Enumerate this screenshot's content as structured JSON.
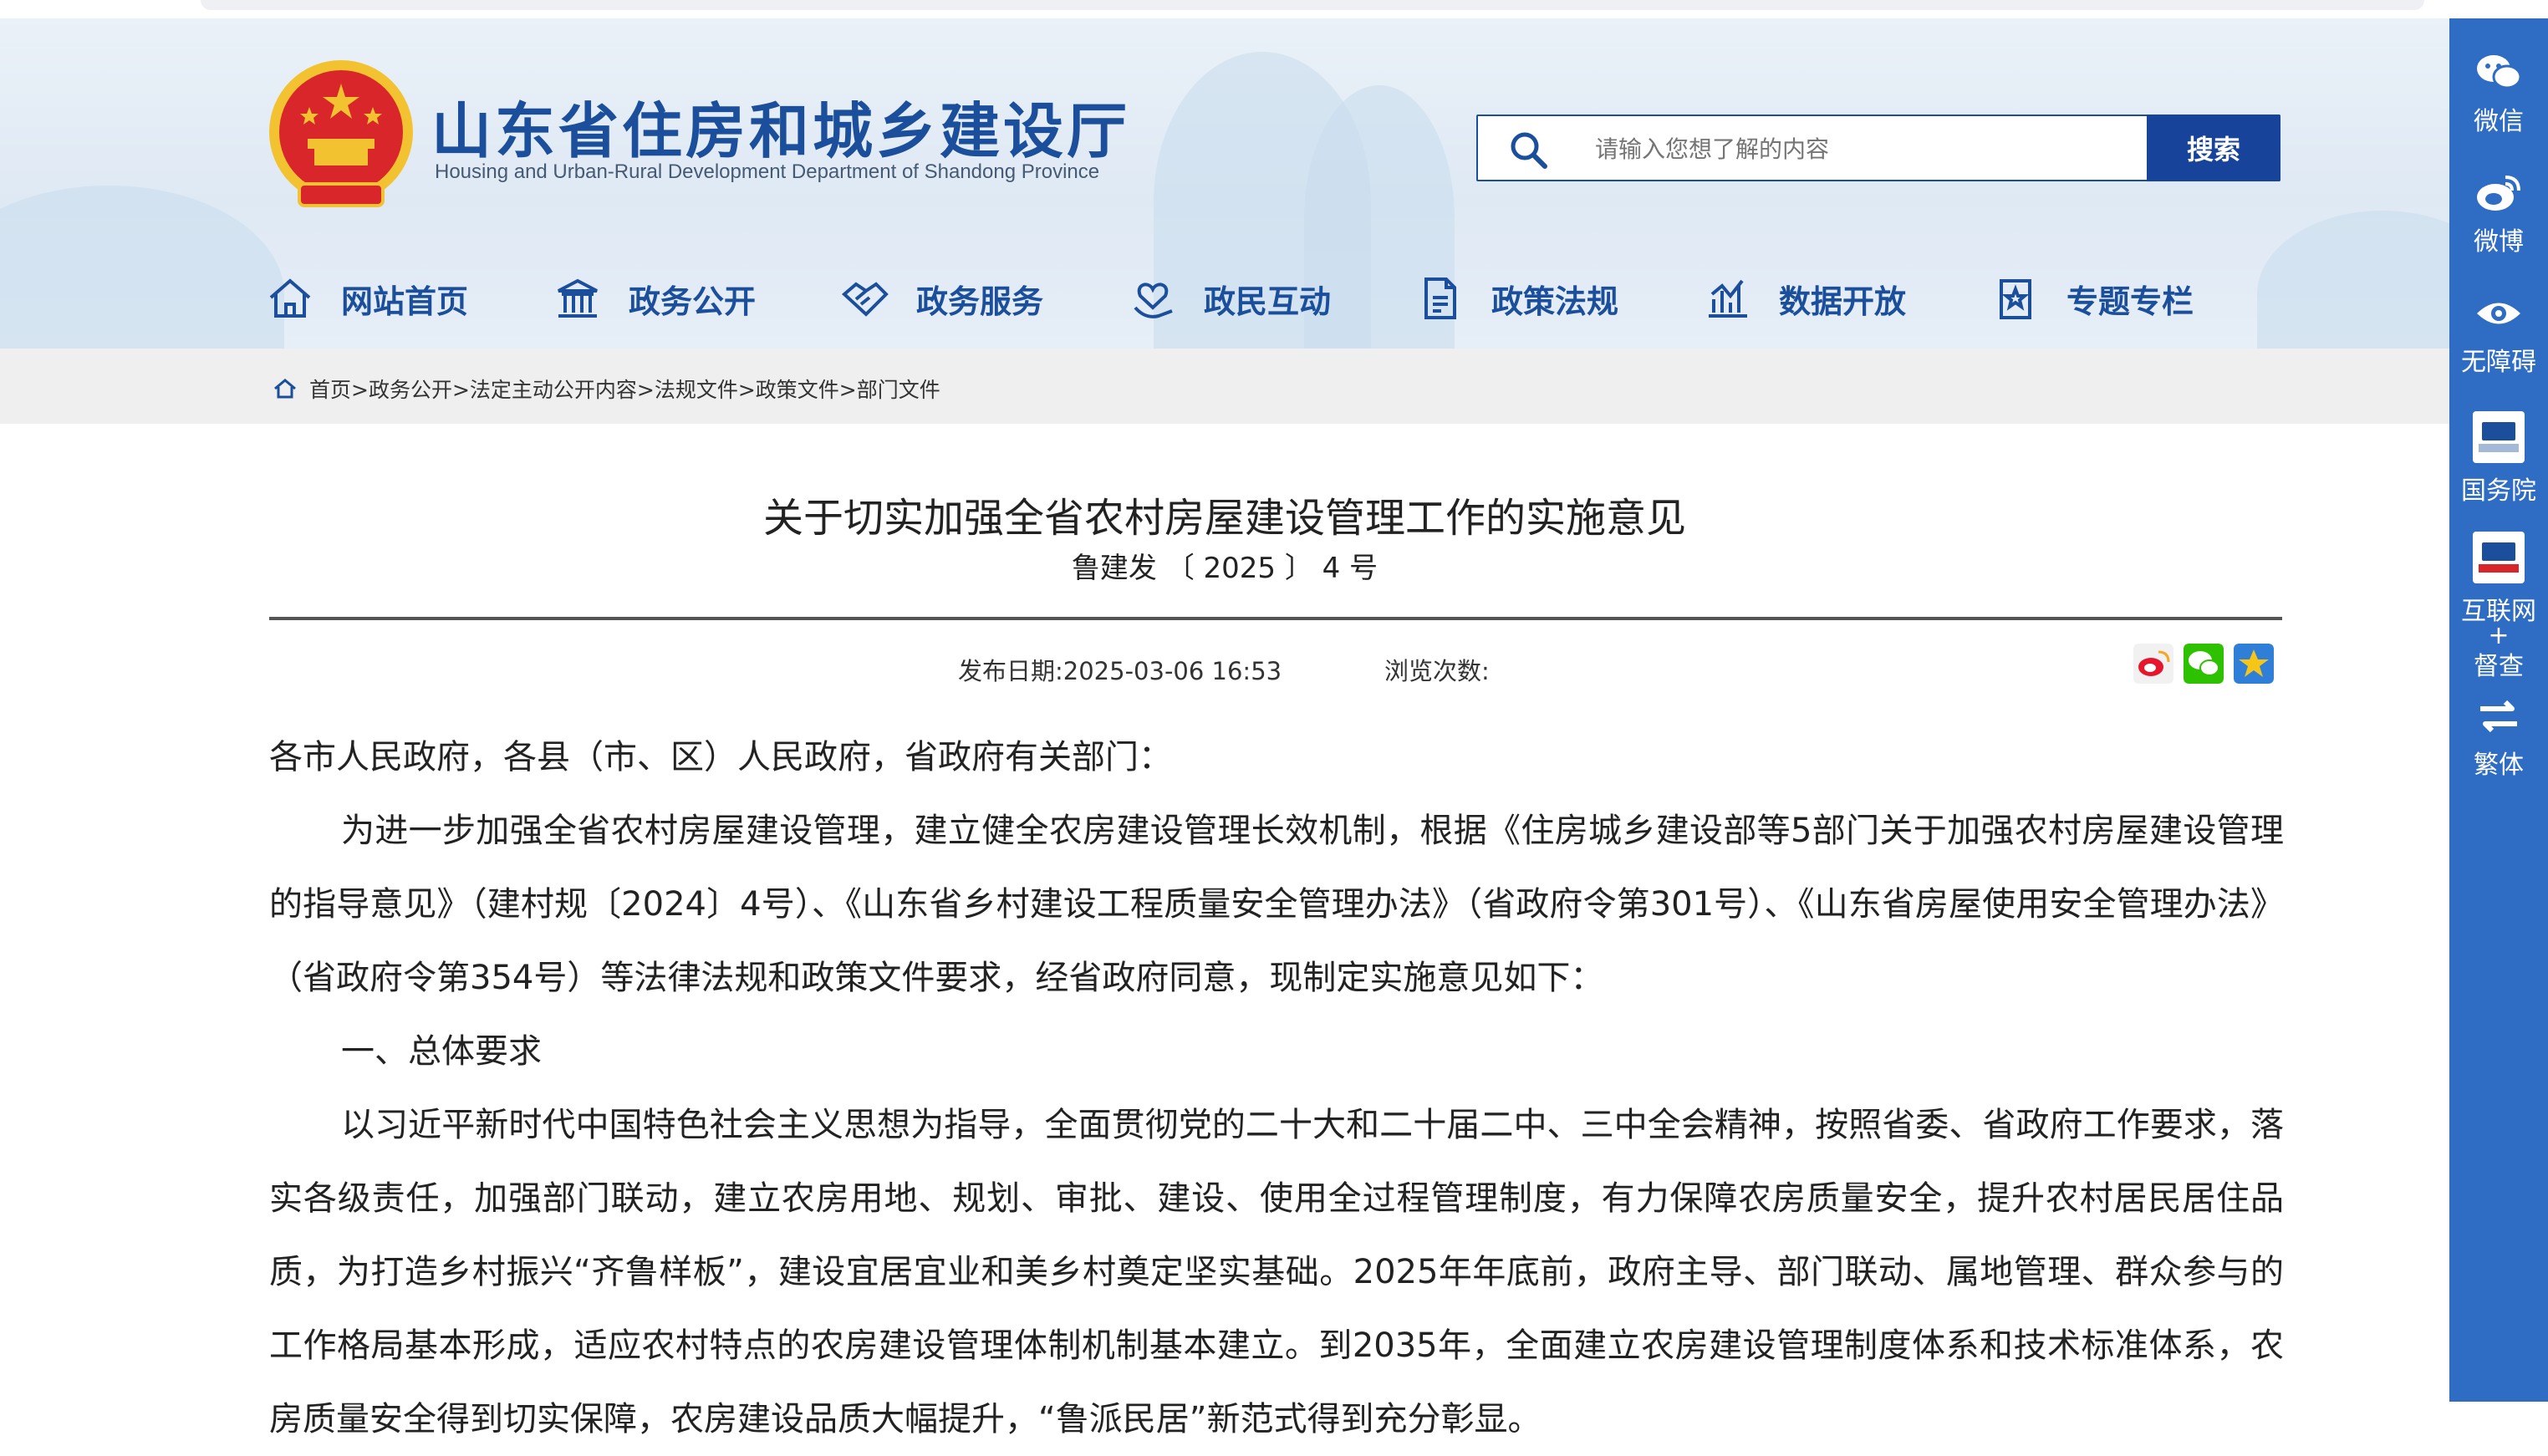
{
  "site": {
    "title": "山东省住房和城乡建设厅",
    "subtitle": "Housing and Urban-Rural Development Department of Shandong Province"
  },
  "search": {
    "placeholder": "请输入您想了解的内容",
    "button": "搜索"
  },
  "nav": [
    {
      "label": "网站首页",
      "icon": "home-icon"
    },
    {
      "label": "政务公开",
      "icon": "government-building-icon"
    },
    {
      "label": "政务服务",
      "icon": "handshake-icon"
    },
    {
      "label": "政民互动",
      "icon": "heart-hand-icon"
    },
    {
      "label": "政策法规",
      "icon": "document-icon"
    },
    {
      "label": "数据开放",
      "icon": "bar-chart-icon"
    },
    {
      "label": "专题专栏",
      "icon": "star-document-icon"
    }
  ],
  "breadcrumb": "首页>政务公开>法定主动公开内容>法规文件>政策文件>部门文件",
  "sidebar": [
    {
      "label": "微信",
      "icon": "wechat-icon"
    },
    {
      "label": "微博",
      "icon": "weibo-icon"
    },
    {
      "label": "无障碍",
      "icon": "eye-icon"
    },
    {
      "label": "国务院",
      "icon": "state-council-icon"
    },
    {
      "label": "互联网+督查",
      "line1": "互联网",
      "line2": "+",
      "line3": "督查",
      "icon": "internet-supervision-icon"
    },
    {
      "label": "繁体",
      "icon": "switch-arrows-icon"
    }
  ],
  "article": {
    "title": "关于切实加强全省农村房屋建设管理工作的实施意见",
    "doc_number": "鲁建发 〔 2025 〕 4 号",
    "publish_date": "发布日期:2025-03-06 16:53",
    "views_label": "浏览次数:",
    "salutation": "各市人民政府，各县（市、区）人民政府，省政府有关部门：",
    "para1": "为进一步加强全省农村房屋建设管理，建立健全农房建设管理长效机制，根据《住房城乡建设部等5部门关于加强农村房屋建设管理的指导意见》（建村规〔2024〕4号）、《山东省乡村建设工程质量安全管理办法》（省政府令第301号）、《山东省房屋使用安全管理办法》（省政府令第354号）等法律法规和政策文件要求，经省政府同意，现制定实施意见如下：",
    "section1": "一、总体要求",
    "para2": "以习近平新时代中国特色社会主义思想为指导，全面贯彻党的二十大和二十届二中、三中全会精神，按照省委、省政府工作要求，落实各级责任，加强部门联动，建立农房用地、规划、审批、建设、使用全过程管理制度，有力保障农房质量安全，提升农村居民居住品质，为打造乡村振兴“齐鲁样板”，建设宜居宜业和美乡村奠定坚实基础。2025年年底前，政府主导、部门联动、属地管理、群众参与的工作格局基本形成，适应农村特点的农房建设管理体制机制基本建立。到2035年，全面建立农房建设管理制度体系和技术标准体系，农房质量安全得到切实保障，农房建设品质大幅提升，“鲁派民居”新范式得到充分彰显。"
  },
  "colors": {
    "brand_blue": "#1b4f9c",
    "sidebar_blue": "#2f6cc4",
    "search_button": "#17439a",
    "emblem_red": "#d8262b",
    "emblem_gold": "#f2c230"
  }
}
